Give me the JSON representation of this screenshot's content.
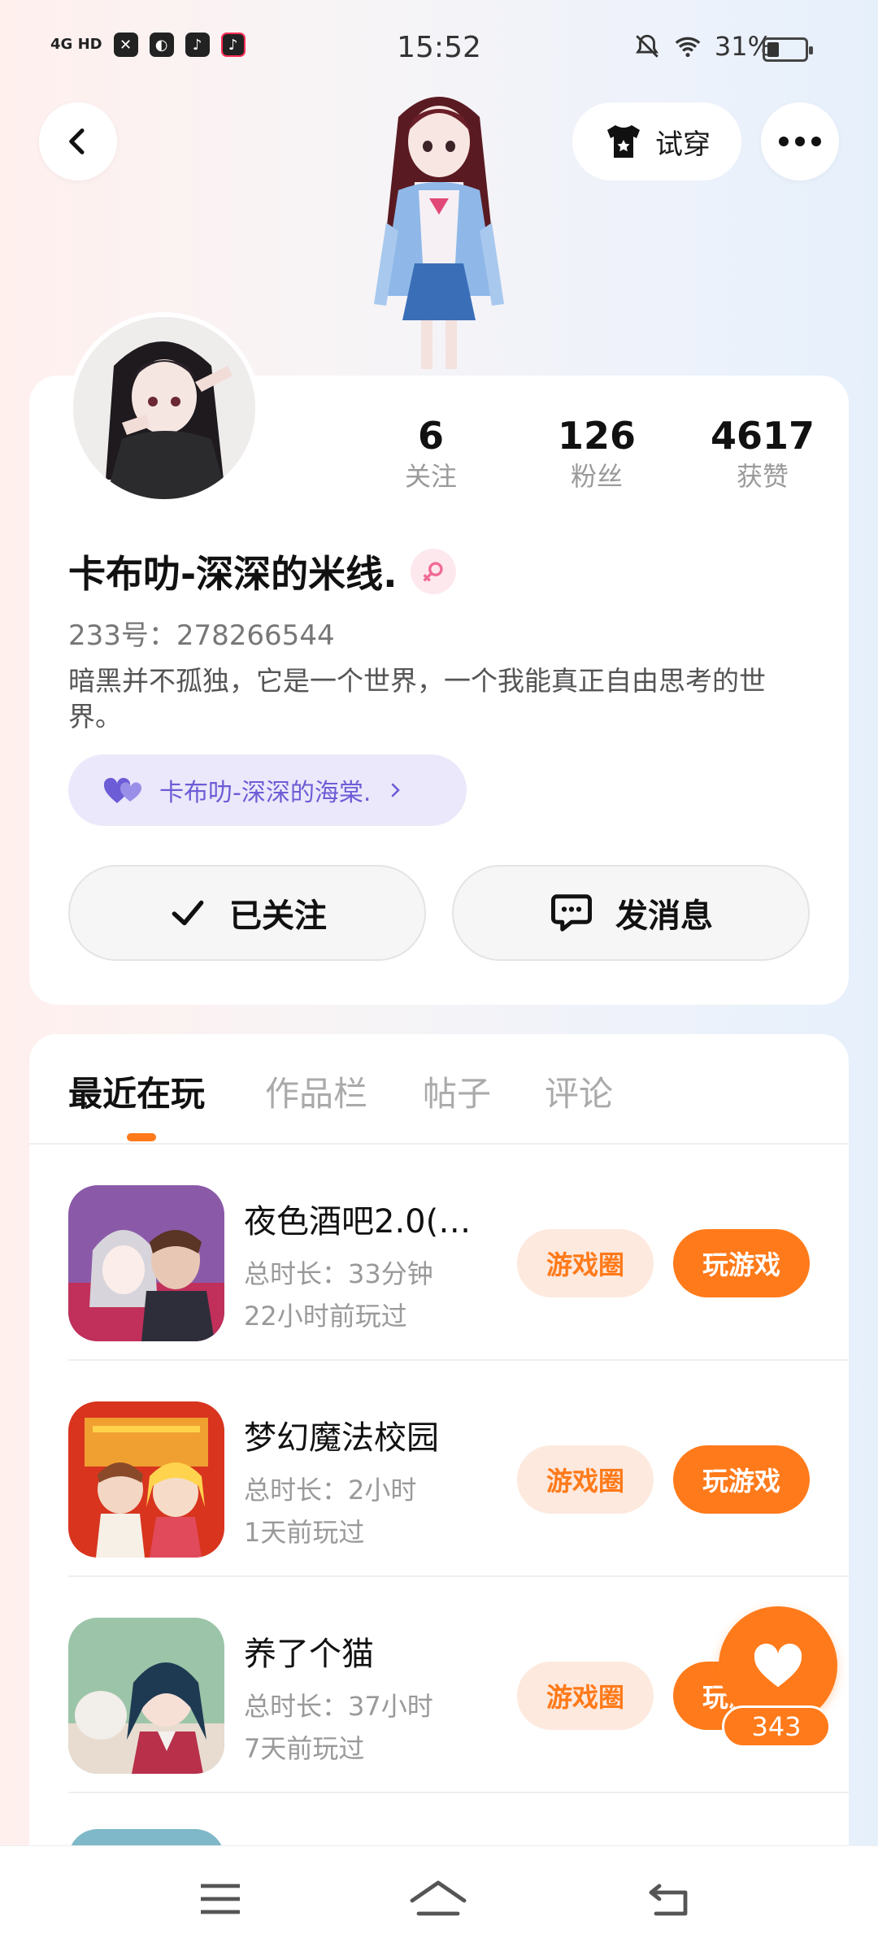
{
  "status_bar": {
    "network": "4G HD",
    "time": "15:52",
    "battery": "31%"
  },
  "header": {
    "try_on_label": "试穿"
  },
  "profile": {
    "stats": [
      {
        "value": "6",
        "label": "关注"
      },
      {
        "value": "126",
        "label": "粉丝"
      },
      {
        "value": "4617",
        "label": "获赞"
      }
    ],
    "username": "卡布叻-深深的米线.",
    "uid": "233号：278266544",
    "bio": "暗黑并不孤独，它是一个世界，一个我能真正自由思考的世界。",
    "cp_name": "卡布叻-深深的海棠.",
    "follow_label": "已关注",
    "message_label": "发消息"
  },
  "tabs": [
    "最近在玩",
    "作品栏",
    "帖子",
    "评论"
  ],
  "games": [
    {
      "title": "夜色酒吧2.0(…",
      "duration": "总时长：33分钟",
      "last_played": "22小时前玩过"
    },
    {
      "title": "梦幻魔法校园",
      "duration": "总时长：2小时",
      "last_played": "1天前玩过"
    },
    {
      "title": "养了个猫",
      "duration": "总时长：37小时",
      "last_played": "7天前玩过"
    }
  ],
  "game_buttons": {
    "circle": "游戏圈",
    "play": "玩游戏"
  },
  "fab": {
    "count": "343"
  },
  "colors": {
    "accent": "#ff7a1a",
    "accent_light": "#fde9de",
    "cp_bg": "#ebe8fb",
    "cp_text": "#6c5cd6"
  }
}
